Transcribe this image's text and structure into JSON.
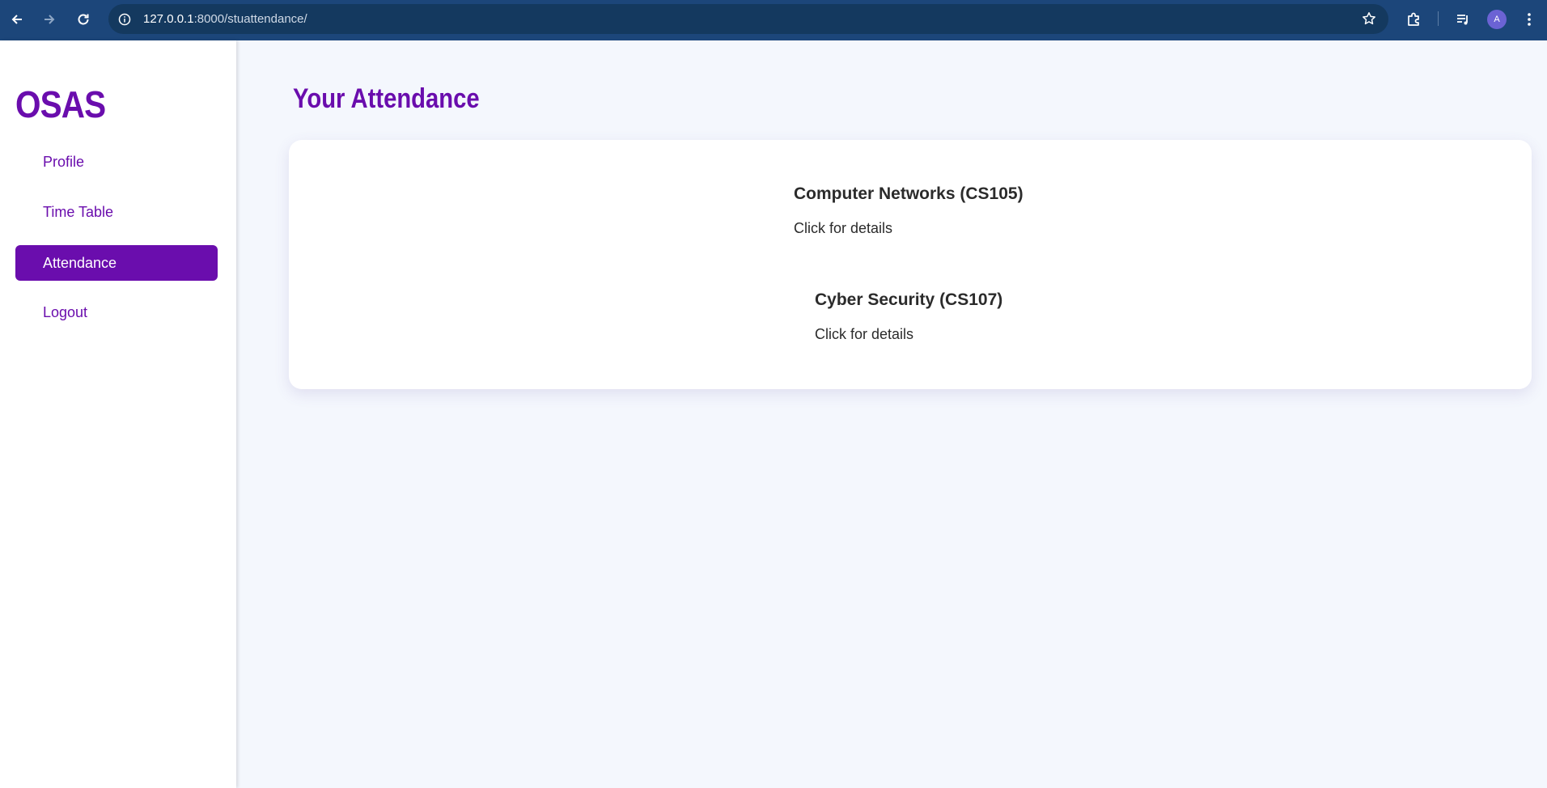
{
  "browser": {
    "url_host": "127.0.0.1",
    "url_path": ":8000/stuattendance/",
    "avatar_letter": "A"
  },
  "sidebar": {
    "brand": "OSAS",
    "items": [
      {
        "label": "Profile",
        "active": false
      },
      {
        "label": "Time Table",
        "active": false
      },
      {
        "label": "Attendance",
        "active": true
      },
      {
        "label": "Logout",
        "active": false
      }
    ]
  },
  "main": {
    "title": "Your Attendance",
    "courses": [
      {
        "name": "Computer Networks (CS105)",
        "hint": "Click for details"
      },
      {
        "name": "Cyber Security (CS107)",
        "hint": "Click for details"
      }
    ]
  },
  "colors": {
    "accent": "#6a0dad",
    "chrome": "#1c467a",
    "background": "#f4f7fd"
  }
}
